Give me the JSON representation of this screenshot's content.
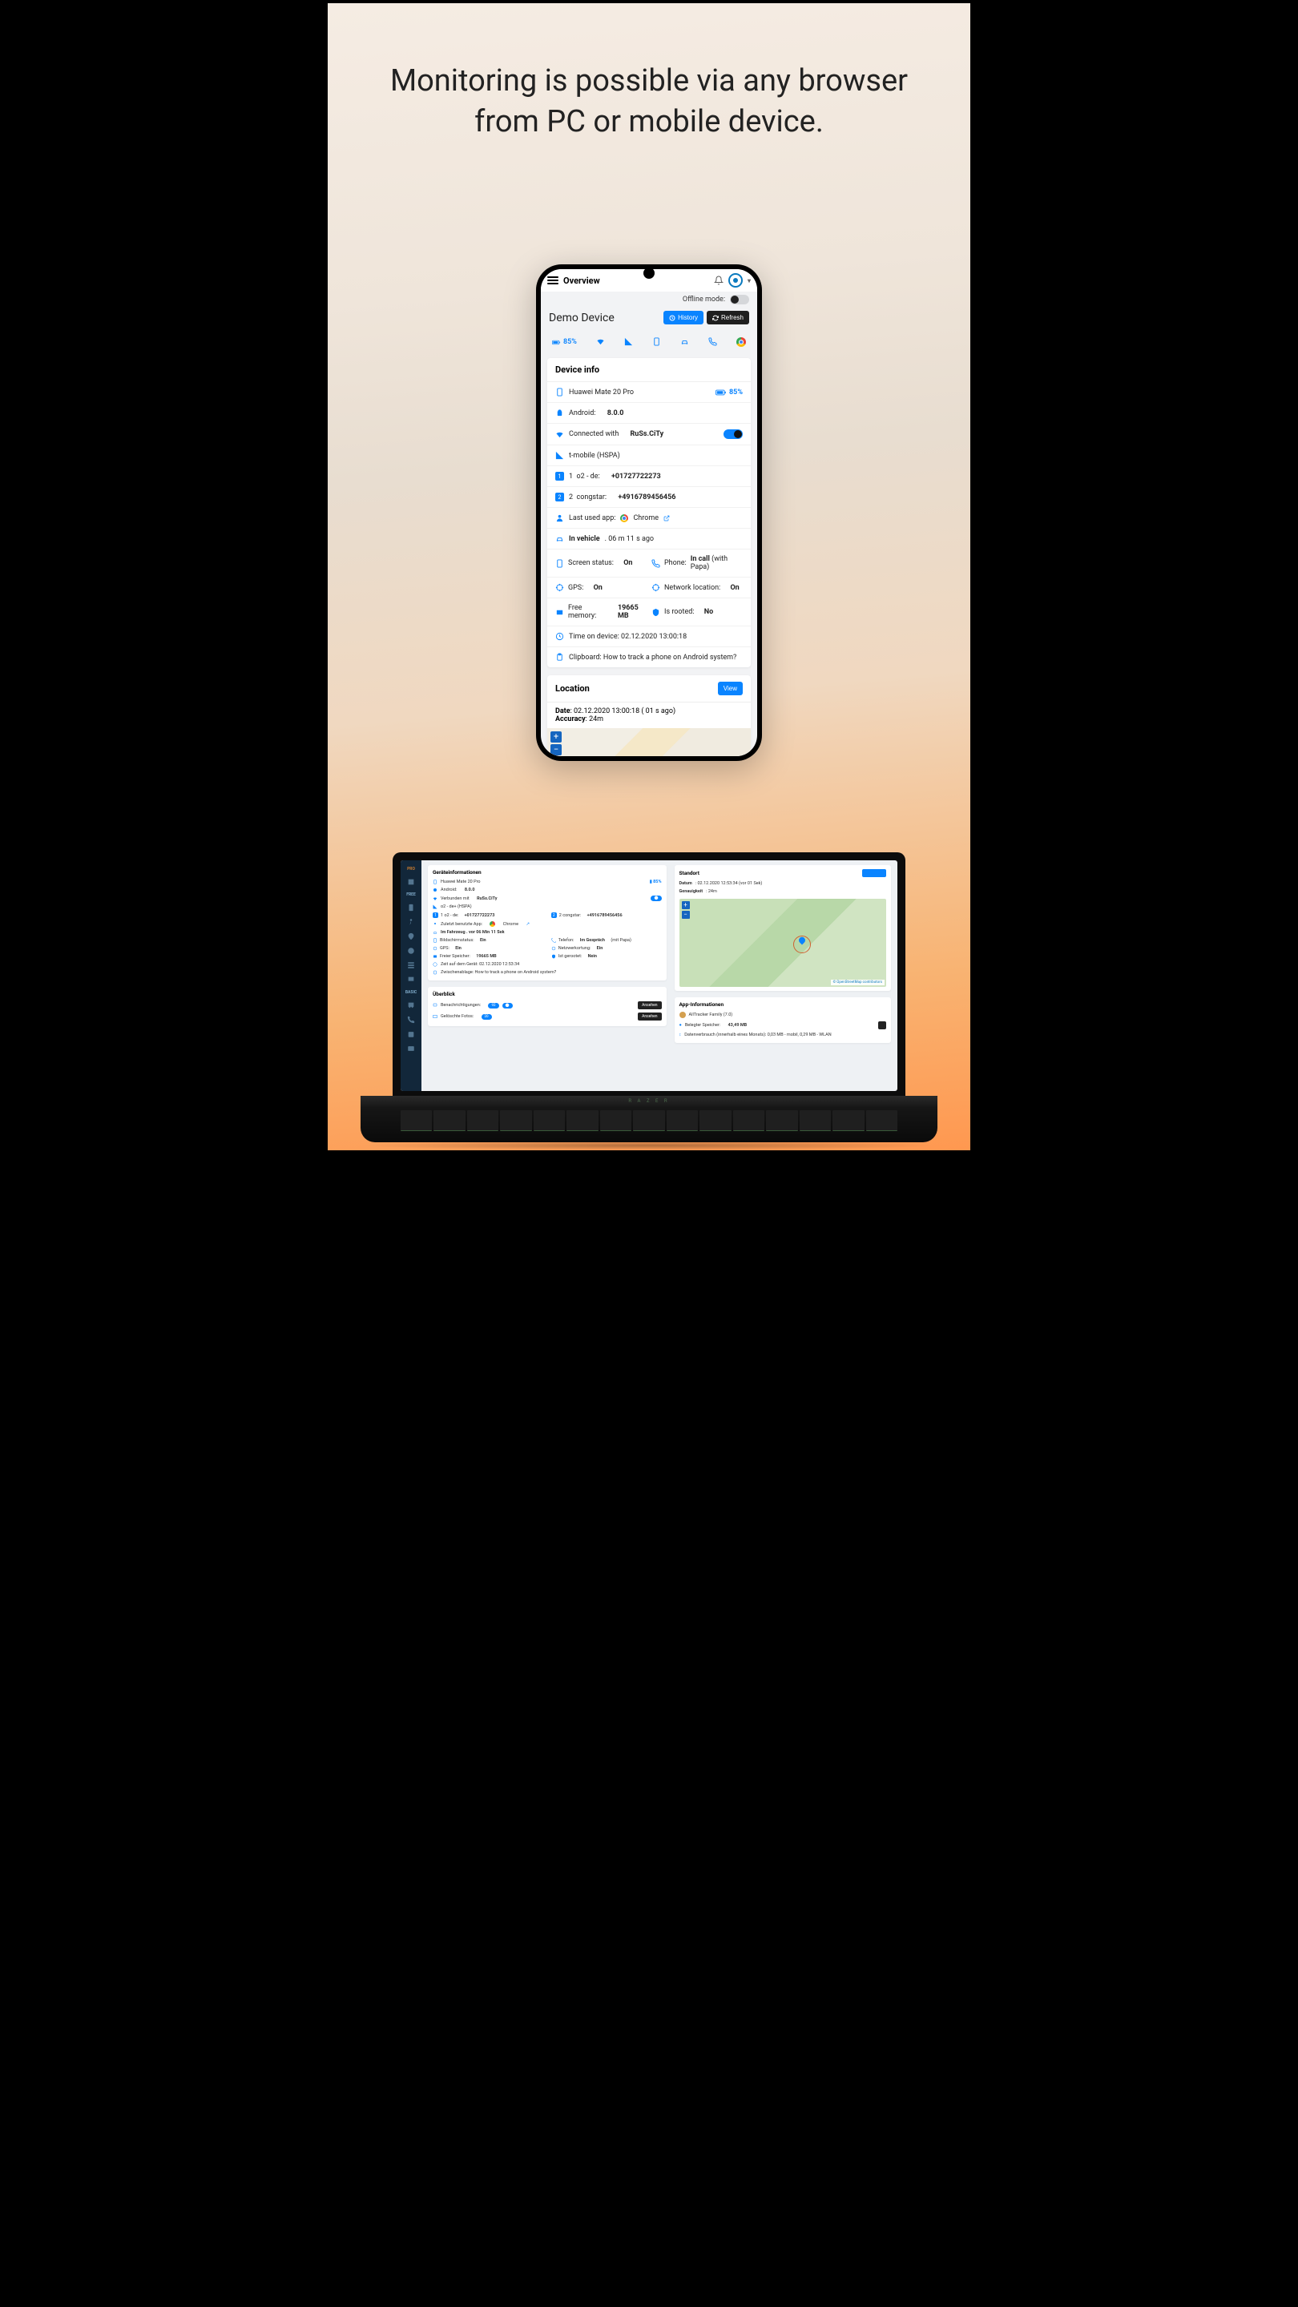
{
  "headline_l1": "Monitoring is possible via any browser",
  "headline_l2": "from PC or mobile device.",
  "phone": {
    "topbar_title": "Overview",
    "offline_label": "Offline mode:",
    "device_title": "Demo Device",
    "btn_history": "History",
    "btn_refresh": "Refresh",
    "battery_pct": "85%",
    "card_device_info": "Device info",
    "rows": {
      "model": "Huawei Mate 20 Pro",
      "model_bat": "85%",
      "android_label": "Android:",
      "android_val": "8.0.0",
      "connected_label": "Connected with",
      "connected_val": "RuSs.CiTy",
      "carrier": "t-mobile (HSPA)",
      "sim1_label": "o2 - de:",
      "sim1_val": "+01727722273",
      "sim2_label": "congstar:",
      "sim2_val": "+4916789456456",
      "last_app_label": "Last used app:",
      "last_app_val": "Chrome",
      "vehicle_label": "In vehicle",
      "vehicle_val": ". 06 m 11 s ago",
      "screen_label": "Screen status:",
      "screen_val": "On",
      "phone_label": "Phone:",
      "phone_val": "In call",
      "phone_extra": "(with Papa)",
      "gps_label": "GPS:",
      "gps_val": "On",
      "netloc_label": "Network location:",
      "netloc_val": "On",
      "mem_label": "Free memory:",
      "mem_val": "19665 MB",
      "root_label": "Is rooted:",
      "root_val": "No",
      "time_label": "Time on device: 02.12.2020 13:00:18",
      "clip_label": "Clipboard: How to track a phone on Android system?"
    },
    "location": {
      "title": "Location",
      "view": "View",
      "date_label": "Date",
      "date_val": ": 02.12.2020 13:00:18 ( 01 s ago)",
      "acc_label": "Accuracy",
      "acc_val": ": 24m"
    }
  },
  "laptop": {
    "side_pro": "PRO",
    "side_free": "FREE",
    "side_basic": "BASIC",
    "device_info": {
      "title": "Geräteinformationen",
      "model": "Huawei Mate 20 Pro",
      "bat": "85%",
      "android_l": "Android:",
      "android_v": "8.0.0",
      "conn_l": "Verbunden mit",
      "conn_v": "RuSs.CiTy",
      "carrier": "o2 - de+ (HSPA)",
      "sim1_l": "o2 - de:",
      "sim1_v": "+01727722273",
      "sim2_l": "congstar:",
      "sim2_v": "+4916789456456",
      "lastapp_l": "Zuletzt benutzte App:",
      "lastapp_v": "Chrome",
      "vehicle": "Im Fahrzeug . vor 06 Min 11 Sek",
      "screen_l": "Bildschirmstatus:",
      "screen_v": "Ein",
      "phone_l": "Telefon:",
      "phone_v": "Im Gespräch",
      "phone_extra": "(mit Papa)",
      "gps_l": "GPS:",
      "gps_v": "Ein",
      "netloc_l": "Netzwerkortung:",
      "netloc_v": "Ein",
      "mem_l": "Freier Speicher:",
      "mem_v": "19665 MB",
      "root_l": "Ist gerootet:",
      "root_v": "Nein",
      "time": "Zeit auf dem Gerät: 02.12.2020 12:53:34",
      "clip": "Zwischenablage: How to track a phone on Android system?"
    },
    "location": {
      "title": "Standort",
      "btn": "Ansehen",
      "date_l": "Datum",
      "date_v": ": 02.12.2020 12:53:34 (vor 01 Sek)",
      "acc_l": "Genauigkeit",
      "acc_v": ": 24m",
      "attr": "© OpenStreetMap contributors"
    },
    "appinfo": {
      "title": "App-Informationen",
      "name": "AllTracker Family (7.0)",
      "storage_l": "Belegter Speicher:",
      "storage_v": "43,49 MB",
      "data": "Datenverbrauch (innerhalb eines Monats): 0,03 MB - mobil, 0,29 MB - WLAN"
    },
    "overview": {
      "title": "Überblick",
      "notif_l": "Benachrichtigungen:",
      "notif_v": "92",
      "photos_l": "Gelöschte Fotos:",
      "photos_v": "20",
      "btn": "Ansehen"
    },
    "brand": "R A Z E R"
  }
}
